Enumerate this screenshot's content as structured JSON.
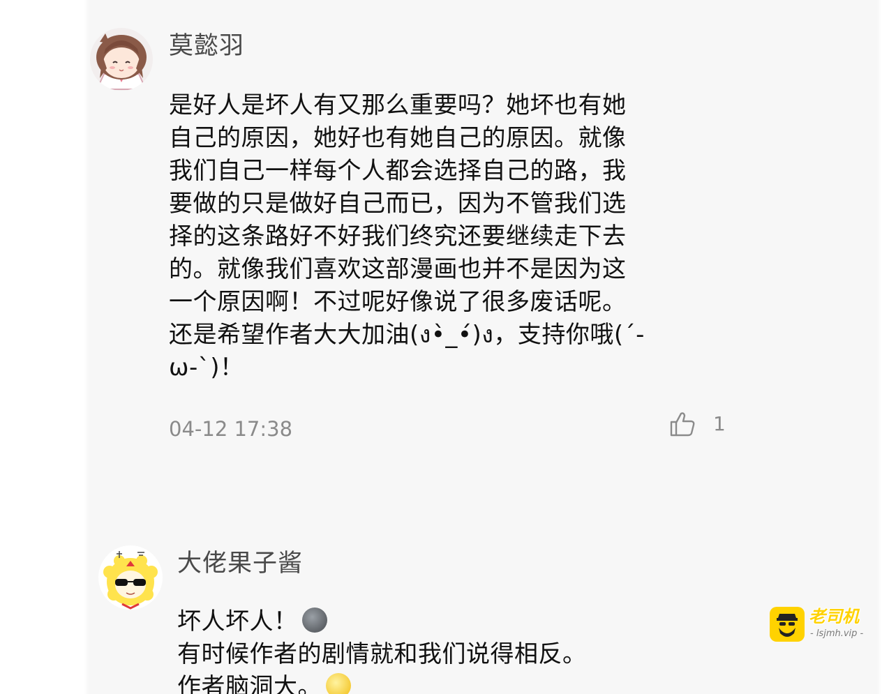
{
  "comments": [
    {
      "username": "莫懿羽",
      "lines": [
        "是好人是坏人有又那么重要吗？她坏也有她",
        "自己的原因，她好也有她自己的原因。就像",
        "我们自己一样每个人都会选择自己的路，我",
        "要做的只是做好自己而已，因为不管我们选",
        "择的这条路好不好我们终究还要继续走下去",
        "的。就像我们喜欢这部漫画也并不是因为这",
        "一个原因啊！不过呢好像说了很多废话呢。",
        "还是希望作者大大加油(ง•̀_•́)ง，支持你哦(´-",
        "ω-`)！"
      ],
      "timestamp": "04-12 17:38",
      "like_count": "1",
      "avatar_icon": "anime-girl-avatar",
      "like_icon": "thumbs-up-icon"
    },
    {
      "username": "大佬果子酱",
      "lines": [
        "坏人坏人！",
        "有时候作者的剧情就和我们说得相反。",
        "作者脑洞大。"
      ],
      "avatar_icon": "sunglasses-cartoon-avatar",
      "inline_emojis": [
        "new-moon-face-emoji",
        "smiling-face-emoji"
      ]
    }
  ],
  "watermark": {
    "title": "老司机",
    "url": "- lsjmh.vip -",
    "icon": "bearded-driver-icon"
  },
  "colors": {
    "panel_background": "#f7f7f7",
    "username": "#4a4a4a",
    "body_text": "#111111",
    "meta_text": "#8a8a8a",
    "watermark_yellow": "#ffd200"
  }
}
